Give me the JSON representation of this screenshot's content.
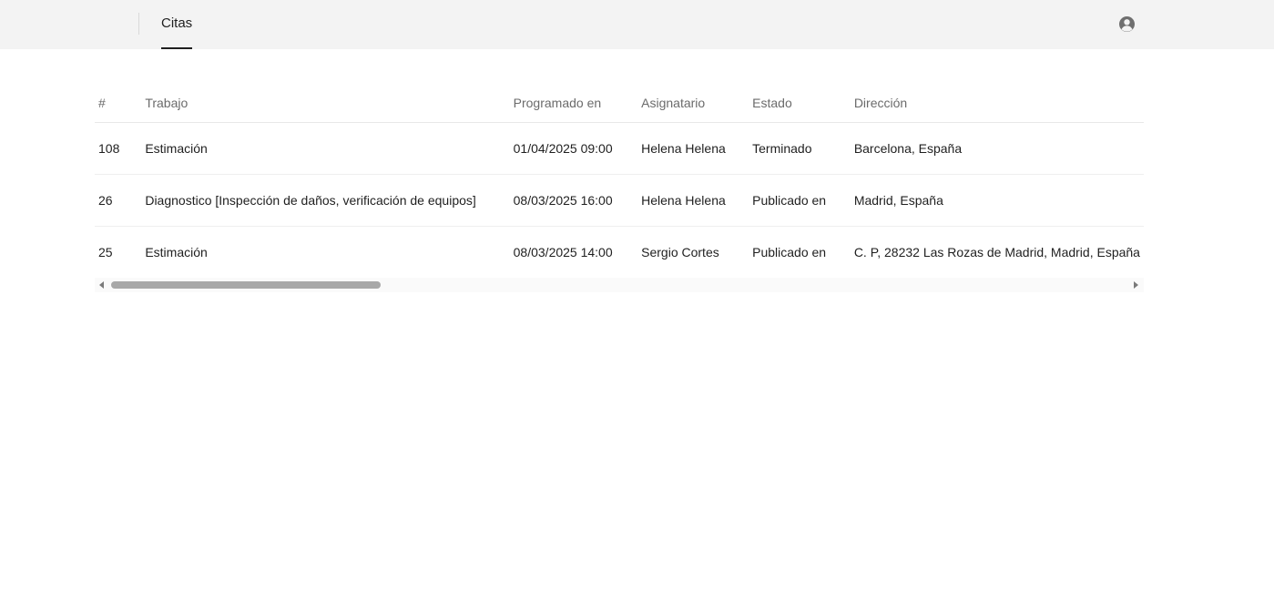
{
  "header": {
    "tab_label": "Citas",
    "account_icon": "user-circle-icon"
  },
  "table": {
    "columns": [
      "#",
      "Trabajo",
      "Programado en",
      "Asignatario",
      "Estado",
      "Dirección"
    ],
    "rows": [
      {
        "id": "108",
        "trabajo": "Estimación",
        "programado": "01/04/2025 09:00",
        "asignatario": "Helena Helena",
        "estado": "Terminado",
        "direccion": "Barcelona, España"
      },
      {
        "id": "26",
        "trabajo": "Diagnostico [Inspección de daños, verificación de equipos]",
        "programado": "08/03/2025 16:00",
        "asignatario": "Helena Helena",
        "estado": "Publicado en",
        "direccion": "Madrid, España"
      },
      {
        "id": "25",
        "trabajo": "Estimación",
        "programado": "08/03/2025 14:00",
        "asignatario": "Sergio Cortes",
        "estado": "Publicado en",
        "direccion": "C. P, 28232 Las Rozas de Madrid, Madrid, España"
      }
    ]
  },
  "colors": {
    "topbar_bg": "#f3f3f3",
    "header_text": "#6b6b6b",
    "body_text": "#1f1f1f"
  }
}
